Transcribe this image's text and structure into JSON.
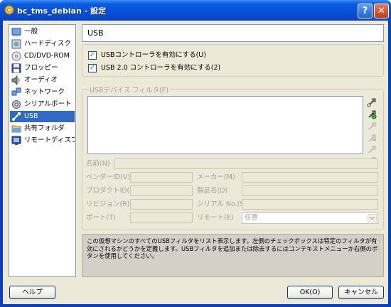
{
  "window": {
    "title": "bc_tms_debian - 設定",
    "help_glyph": "?",
    "close_glyph": "✕"
  },
  "sidebar": {
    "items": [
      {
        "label": "一般",
        "icon": "general-icon"
      },
      {
        "label": "ハードディスク",
        "icon": "harddisk-icon"
      },
      {
        "label": "CD/DVD-ROM",
        "icon": "cd-dvd-icon"
      },
      {
        "label": "フロッピー",
        "icon": "floppy-icon"
      },
      {
        "label": "オーディオ",
        "icon": "audio-icon"
      },
      {
        "label": "ネットワーク",
        "icon": "network-icon"
      },
      {
        "label": "シリアルポート",
        "icon": "serial-port-icon"
      },
      {
        "label": "USB",
        "icon": "usb-icon",
        "selected": true
      },
      {
        "label": "共有フォルダ",
        "icon": "shared-folder-icon"
      },
      {
        "label": "リモートディスプレイ",
        "icon": "remote-display-icon"
      }
    ]
  },
  "header": {
    "title": "USB"
  },
  "usb": {
    "enable_controller": "USBコントローラを有効にする(U)",
    "enable_controller_checked": true,
    "enable_usb2": "USB 2.0 コントローラを有効にする(2)",
    "enable_usb2_checked": true,
    "check_glyph": "✓"
  },
  "filters": {
    "legend": "USBデバイス フィルタ(F)",
    "fields": {
      "name_label": "名前(N)",
      "vendor_id_label": "ベンダーID(V)",
      "product_id_label": "プロダクトID(P)",
      "revision_label": "リビジョン(R)",
      "port_label": "ポート(T)",
      "manufacturer_label": "メーカー(M)",
      "product_name_label": "製品名(D)",
      "serial_label": "シリアル No.(S)",
      "remote_label": "リモート(E)",
      "remote_value": "任意"
    }
  },
  "info_text": "この仮想マシンのすべてのUSBフィルタをリスト表示します。左側のチェックボックスは特定のフィルタが有効にされるかどうかを定義します。USBフィルタを追加または除去するにはコンテキストメニューか右側のボタンを使用してください。",
  "buttons": {
    "help": "ヘルプ",
    "ok": "OK(O)",
    "cancel": "キャンセル"
  },
  "colors": {
    "titlebar": "#0650d8",
    "selection": "#316ac5",
    "dialog_bg": "#ece9d8"
  }
}
